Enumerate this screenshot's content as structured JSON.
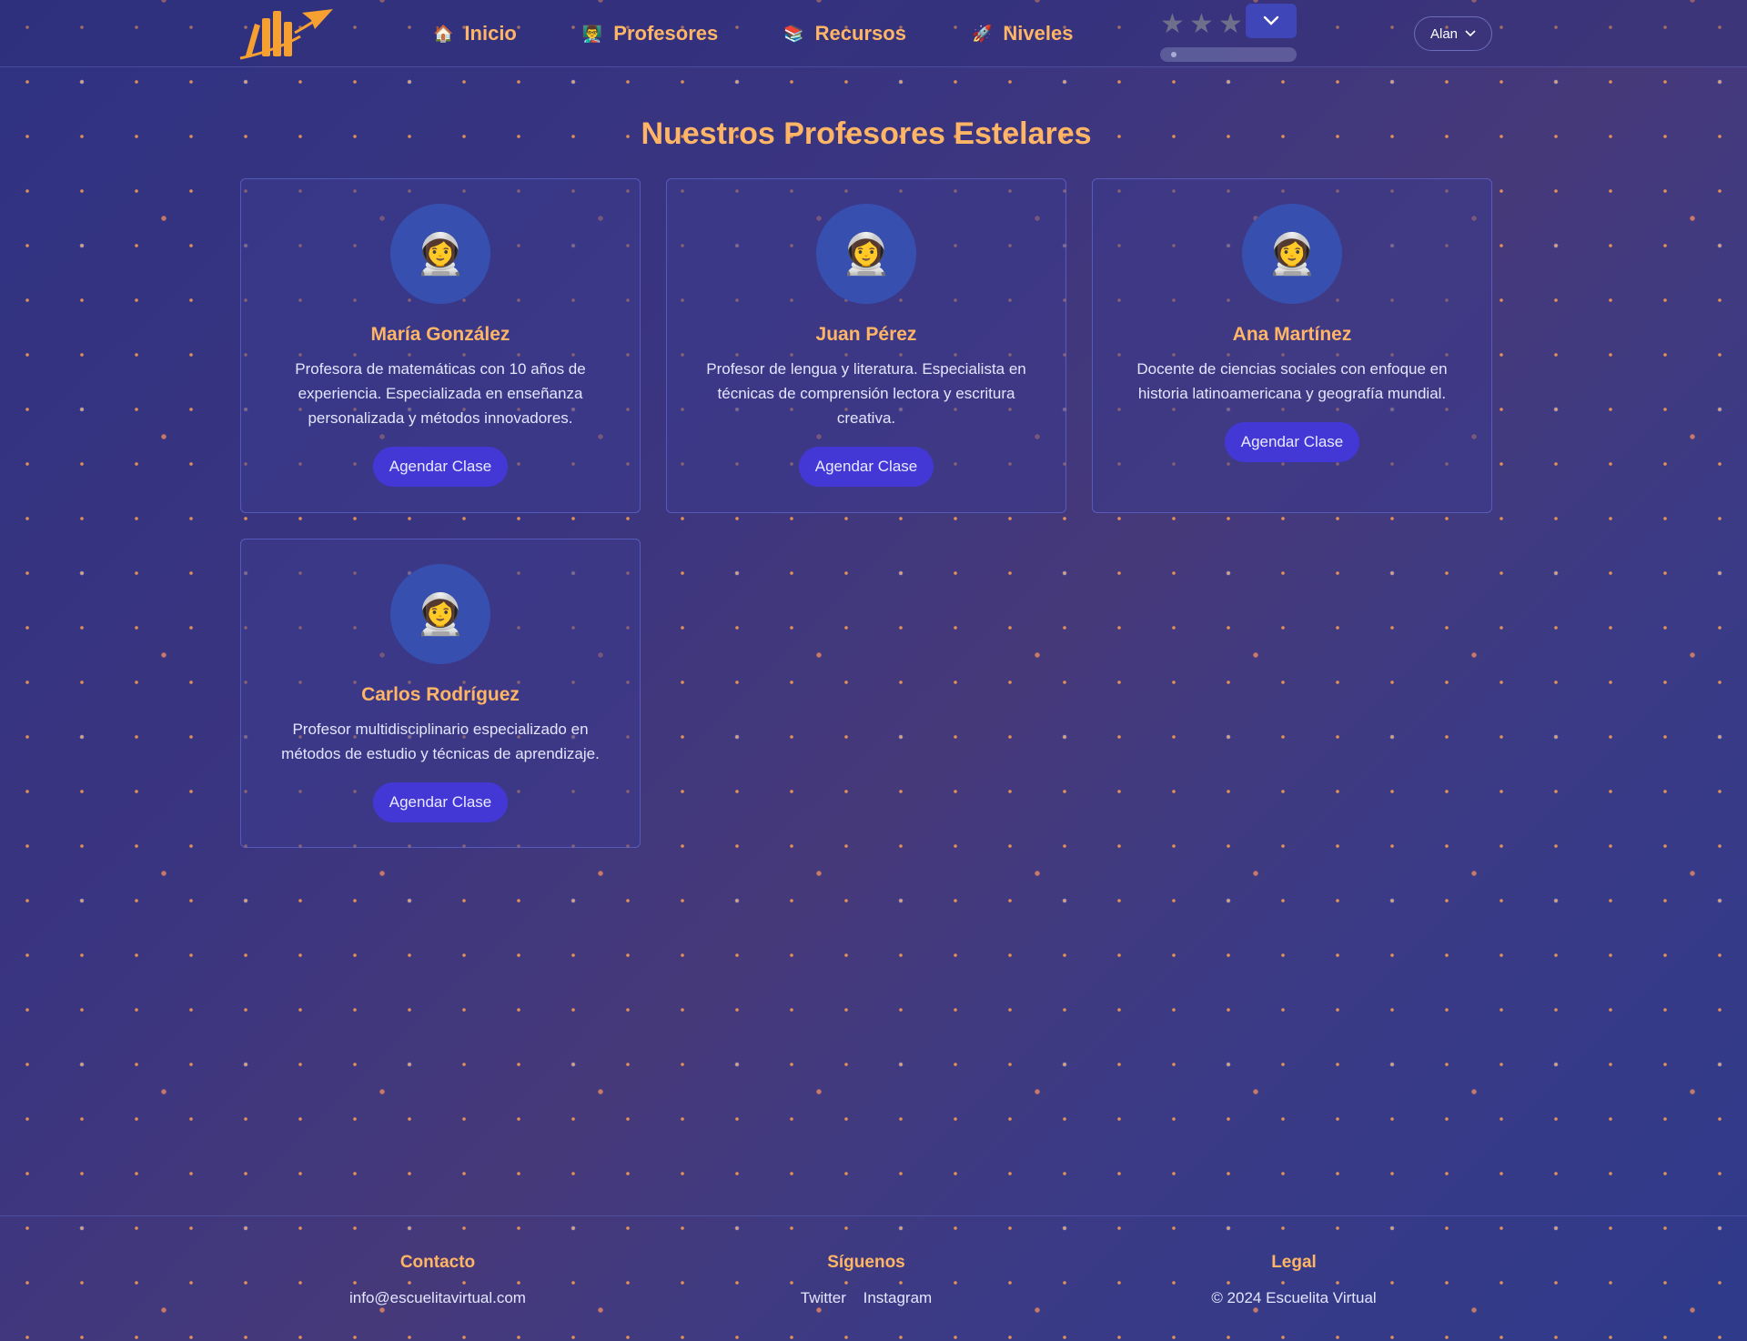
{
  "nav": {
    "items": [
      {
        "label": "Inicio",
        "icon": "🏠"
      },
      {
        "label": "Profesores",
        "icon": "👨‍🏫"
      },
      {
        "label": "Recursos",
        "icon": "📚"
      },
      {
        "label": "Niveles",
        "icon": "🚀"
      }
    ]
  },
  "rating": {
    "star_glyph": "★",
    "stars": 3,
    "progress": 0.05
  },
  "user": {
    "name": "Alan"
  },
  "page": {
    "title": "Nuestros Profesores Estelares"
  },
  "teachers": [
    {
      "name": "María González",
      "description": "Profesora de matemáticas con 10 años de experiencia. Especializada en enseñanza personalizada y métodos innovadores.",
      "button": "Agendar Clase",
      "avatar": "👩‍🚀"
    },
    {
      "name": "Juan Pérez",
      "description": "Profesor de lengua y literatura. Especialista en técnicas de comprensión lectora y escritura creativa.",
      "button": "Agendar Clase",
      "avatar": "👩‍🚀"
    },
    {
      "name": "Ana Martínez",
      "description": "Docente de ciencias sociales con enfoque en historia latinoamericana y geografía mundial.",
      "button": "Agendar Clase",
      "avatar": "👩‍🚀"
    },
    {
      "name": "Carlos Rodríguez",
      "description": "Profesor multidisciplinario especializado en métodos de estudio y técnicas de aprendizaje.",
      "button": "Agendar Clase",
      "avatar": "👩‍🚀"
    }
  ],
  "footer": {
    "contact": {
      "title": "Contacto",
      "email": "info@escuelitavirtual.com"
    },
    "social": {
      "title": "Síguenos",
      "twitter": "Twitter",
      "instagram": "Instagram"
    },
    "legal": {
      "title": "Legal",
      "text": "© 2024 Escuelita Virtual"
    }
  },
  "colors": {
    "accent": "#ffb566",
    "button": "#4338d6",
    "avatar_bg": "#3750b0"
  }
}
